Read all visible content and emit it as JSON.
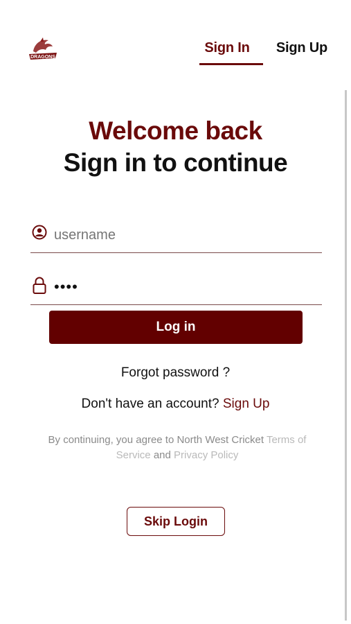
{
  "brand": {
    "logo_name": "dragons-logo",
    "logo_text": "DRAGONS",
    "color": "#7a1010"
  },
  "nav": {
    "sign_in": "Sign In",
    "sign_up": "Sign Up",
    "active": "sign_in"
  },
  "header": {
    "welcome": "Welcome back",
    "subtitle": "Sign in to continue"
  },
  "form": {
    "username": {
      "icon": "user-circle-icon",
      "value": "",
      "placeholder": "username"
    },
    "password": {
      "icon": "lock-icon",
      "value": "••••"
    },
    "login_label": "Log in"
  },
  "links": {
    "forgot": "Forgot password ?",
    "no_account_text": "Don't have an account?",
    "sign_up": "Sign Up"
  },
  "terms": {
    "prefix": "By continuing, you agree to North West Cricket",
    "terms_link": "Terms of Service",
    "and": "and",
    "privacy_link": "Privacy Policy"
  },
  "skip_label": "Skip Login",
  "colors": {
    "accent": "#620000",
    "text": "#111111",
    "muted": "#8a8a8a",
    "light_link": "#b9b9b9"
  }
}
